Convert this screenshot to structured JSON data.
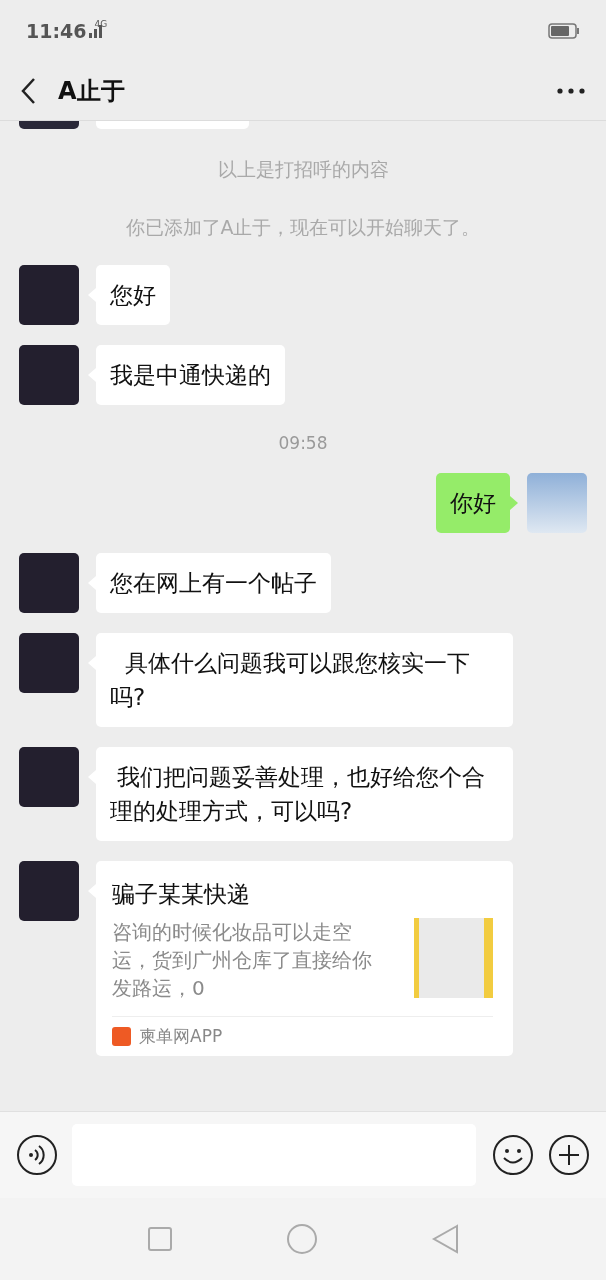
{
  "status_bar": {
    "time": "11:46",
    "network": "4G"
  },
  "header": {
    "title": "A止于"
  },
  "messages": [
    {
      "kind": "system",
      "text": "以上是打招呼的内容"
    },
    {
      "kind": "system",
      "text": "你已添加了A止于，现在可以开始聊天了。"
    },
    {
      "kind": "text",
      "outgoing": false,
      "text": "您好"
    },
    {
      "kind": "text",
      "outgoing": false,
      "text": "我是中通快递的"
    },
    {
      "kind": "time",
      "text": "09:58"
    },
    {
      "kind": "text",
      "outgoing": true,
      "text": "你好"
    },
    {
      "kind": "text",
      "outgoing": false,
      "text": "您在网上有一个帖子"
    },
    {
      "kind": "text",
      "outgoing": false,
      "text": "  具体什么问题我可以跟您核实一下吗?"
    },
    {
      "kind": "text",
      "outgoing": false,
      "text": " 我们把问题妥善处理，也好给您个合理的处理方式，可以吗?"
    },
    {
      "kind": "link",
      "outgoing": false,
      "title": "骗子某某快递",
      "description": "咨询的时候化妆品可以走空运，货到广州仓库了直接给你发路运，0",
      "source": "柬单网APP"
    }
  ]
}
